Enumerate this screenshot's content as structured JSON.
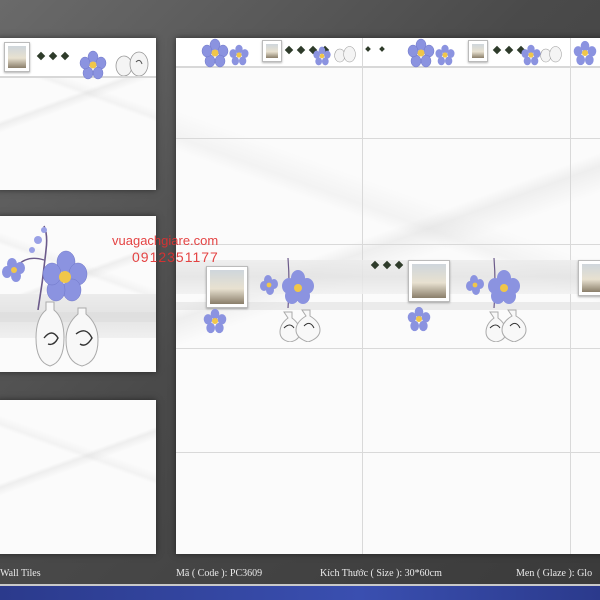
{
  "watermark": {
    "site": "vuagachgiare.com",
    "phone": "0912351177"
  },
  "caption": {
    "type": "Wall Tiles",
    "code": "Mã ( Code ): PC3609",
    "size": "Kích Thước ( Size ): 30*60cm",
    "glaze": "Men ( Glaze ): Glo"
  },
  "colors": {
    "background": "#4f4f4f",
    "flower": "#8b93e0",
    "watermark": "#e23030",
    "stripe": "#2b3a8c"
  },
  "icons": [
    "blue-flower-icon",
    "vase-icon",
    "framed-photo-icon",
    "diamond-icon"
  ]
}
